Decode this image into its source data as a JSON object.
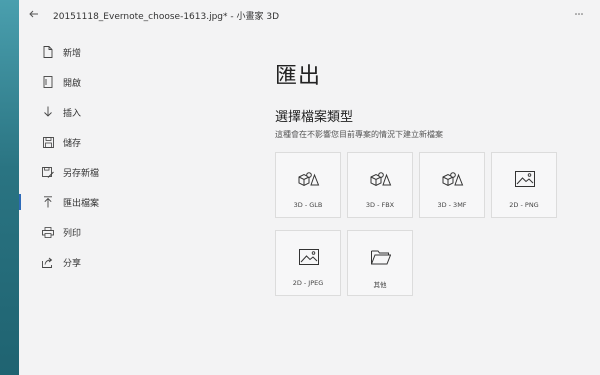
{
  "window": {
    "title": "20151118_Evernote_choose-1613.jpg* - 小畫家 3D",
    "back_icon": "back-arrow-icon",
    "more_icon": "more-dots-icon"
  },
  "sidebar": {
    "items": [
      {
        "label": "新增",
        "icon": "new-file-icon",
        "active": false
      },
      {
        "label": "開啟",
        "icon": "open-file-icon",
        "active": false
      },
      {
        "label": "插入",
        "icon": "insert-arrow-icon",
        "active": false
      },
      {
        "label": "儲存",
        "icon": "save-icon",
        "active": false
      },
      {
        "label": "另存新檔",
        "icon": "save-as-icon",
        "active": false
      },
      {
        "label": "匯出檔案",
        "icon": "export-arrow-icon",
        "active": true
      },
      {
        "label": "列印",
        "icon": "print-icon",
        "active": false
      },
      {
        "label": "分享",
        "icon": "share-icon",
        "active": false
      }
    ],
    "accent_color": "#2d6ab8"
  },
  "main": {
    "title": "匯出",
    "section_title": "選擇檔案類型",
    "section_desc": "這種會在不影響您目前專案的情況下建立新檔案",
    "tiles": [
      {
        "label": "3D - GLB",
        "icon": "3d-shapes-icon"
      },
      {
        "label": "3D - FBX",
        "icon": "3d-shapes-icon"
      },
      {
        "label": "3D - 3MF",
        "icon": "3d-shapes-icon"
      },
      {
        "label": "2D - PNG",
        "icon": "image-icon"
      },
      {
        "label": "2D - JPEG",
        "icon": "image-icon"
      },
      {
        "label": "其他",
        "icon": "folder-icon"
      }
    ]
  }
}
